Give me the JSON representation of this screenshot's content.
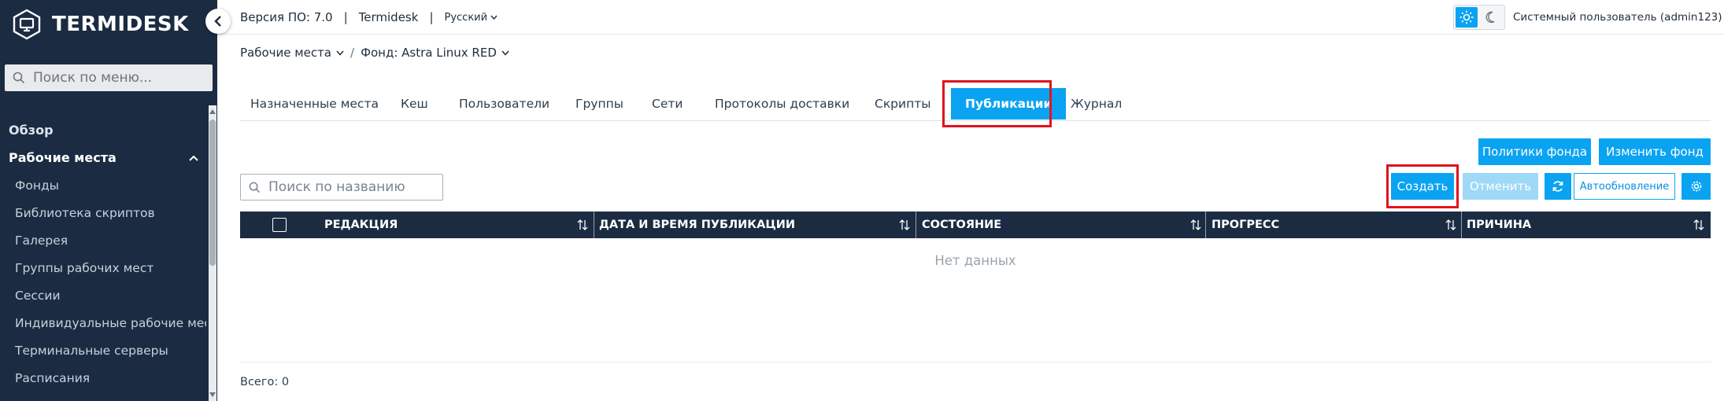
{
  "app": {
    "brand": "TERMIDESK"
  },
  "sidebar": {
    "search_placeholder": "Поиск по меню...",
    "items": [
      {
        "label": "Обзор"
      },
      {
        "label": "Рабочие места"
      },
      {
        "label": "Фонды"
      },
      {
        "label": "Библиотека скриптов"
      },
      {
        "label": "Галерея"
      },
      {
        "label": "Группы рабочих мест"
      },
      {
        "label": "Сессии"
      },
      {
        "label": "Индивидуальные рабочие места"
      },
      {
        "label": "Терминальные серверы"
      },
      {
        "label": "Расписания"
      }
    ]
  },
  "header": {
    "version": "Версия ПО: 7.0",
    "sep": "|",
    "product": "Termidesk",
    "language": "Русский",
    "user": "Системный пользователь (admin123)"
  },
  "breadcrumb": {
    "section": "Рабочие места",
    "separator": "/",
    "current": "Фонд: Astra Linux RED"
  },
  "tabs": [
    {
      "label": "Назначенные места"
    },
    {
      "label": "Кеш"
    },
    {
      "label": "Пользователи"
    },
    {
      "label": "Группы"
    },
    {
      "label": "Сети"
    },
    {
      "label": "Протоколы доставки"
    },
    {
      "label": "Скрипты"
    },
    {
      "label": "Публикации"
    },
    {
      "label": "Журнал"
    }
  ],
  "actions": {
    "pool_policies": "Политики фонда",
    "edit_pool": "Изменить фонд",
    "create": "Создать",
    "cancel": "Отменить",
    "autorefresh": "Автообновление"
  },
  "search": {
    "placeholder": "Поиск по названию"
  },
  "table": {
    "columns": [
      {
        "label": "РЕДАКЦИЯ"
      },
      {
        "label": "ДАТА И ВРЕМЯ ПУБЛИКАЦИИ"
      },
      {
        "label": "СОСТОЯНИЕ"
      },
      {
        "label": "ПРОГРЕСС"
      },
      {
        "label": "ПРИЧИНА"
      }
    ],
    "empty_text": "Нет данных",
    "total": "Всего: 0"
  },
  "colors": {
    "sidebar_bg": "#1b2c42",
    "accent": "#0aa3f2",
    "highlight_box": "#e0141e",
    "table_header_bg": "#1b2c42"
  },
  "icons": [
    "logo-icon",
    "chevron-left-icon",
    "search-icon",
    "chevron-up-icon",
    "chevron-down-icon",
    "sun-icon",
    "moon-icon",
    "refresh-icon",
    "gear-icon",
    "sort-icon",
    "checkbox-icon"
  ]
}
